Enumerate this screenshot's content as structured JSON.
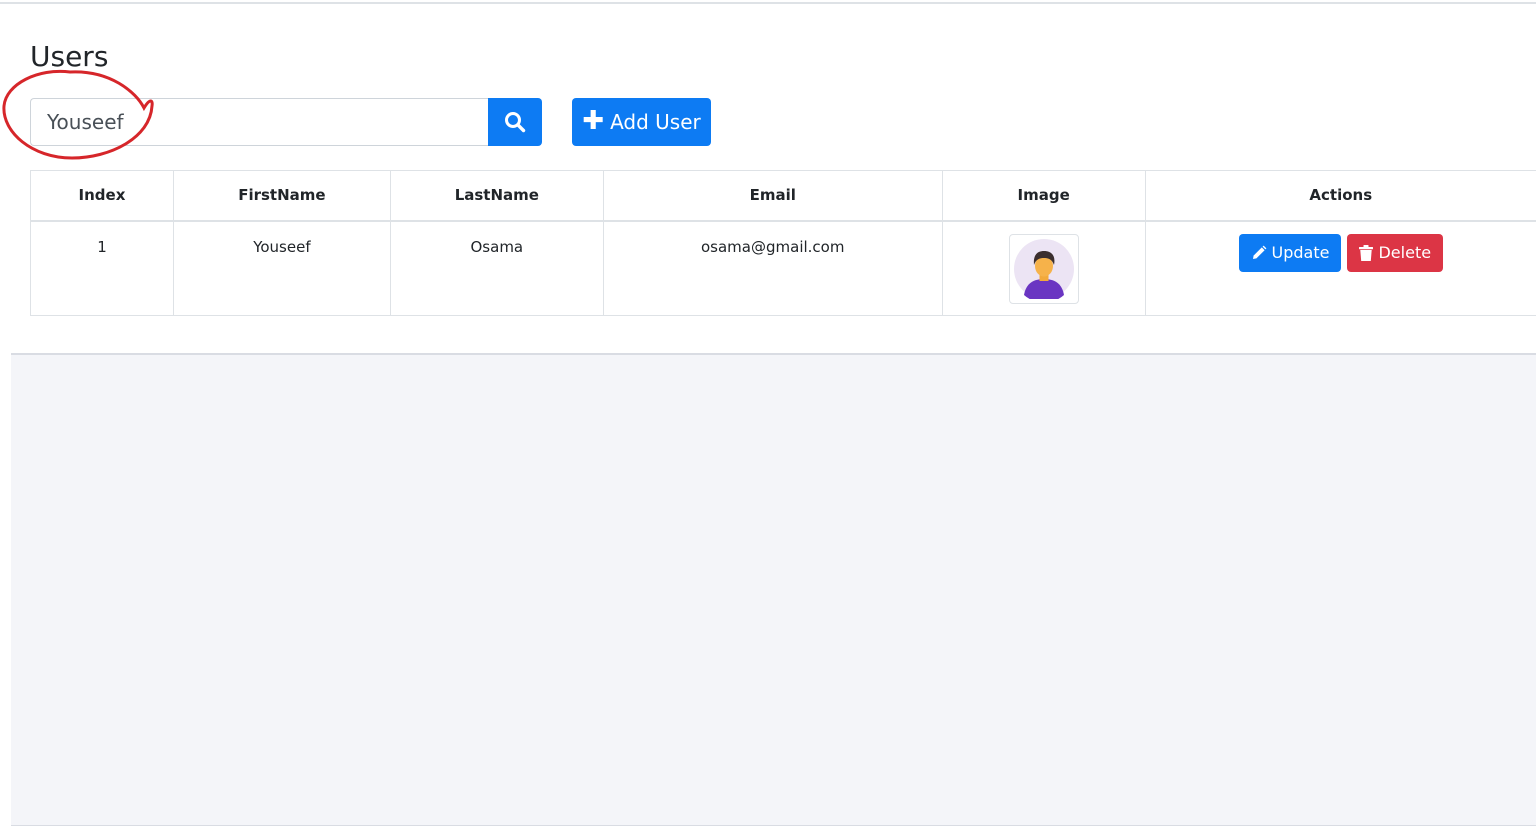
{
  "page": {
    "title": "Users"
  },
  "search": {
    "value": "Youseef",
    "button_icon": "search-icon"
  },
  "toolbar": {
    "add_user_label": "Add User",
    "add_icon": "plus-icon"
  },
  "table": {
    "headers": [
      "Index",
      "FirstName",
      "LastName",
      "Email",
      "Image",
      "Actions"
    ],
    "rows": [
      {
        "index": "1",
        "first_name": "Youseef",
        "last_name": "Osama",
        "email": "osama@gmail.com",
        "image": "avatar-icon",
        "update_label": "Update",
        "delete_label": "Delete"
      }
    ]
  },
  "colors": {
    "primary": "#0d7bf3",
    "danger": "#dc3545",
    "annotation": "#d6262a",
    "background": "#f4f5f9"
  }
}
